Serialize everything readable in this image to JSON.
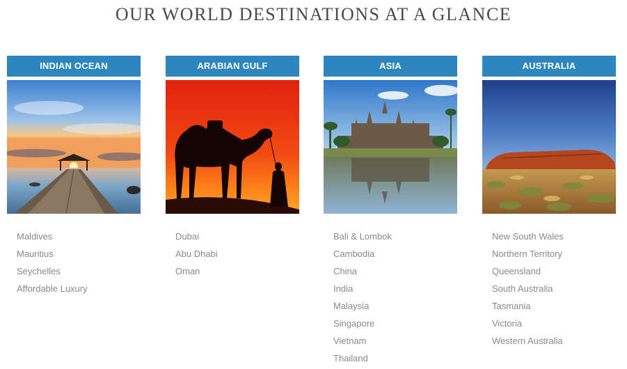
{
  "heading": "OUR WORLD DESTINATIONS AT A GLANCE",
  "accent_color": "#2d86bd",
  "columns": [
    {
      "title": "INDIAN OCEAN",
      "image": "jetty-sunset-photo",
      "items": [
        "Maldives",
        "Mauritius",
        "Seychelles",
        "Affordable Luxury"
      ]
    },
    {
      "title": "ARABIAN GULF",
      "image": "camel-silhouette-photo",
      "items": [
        "Dubai",
        "Abu Dhabi",
        "Oman"
      ]
    },
    {
      "title": "ASIA",
      "image": "angkor-wat-photo",
      "items": [
        "Bali & Lombok",
        "Cambodia",
        "China",
        "India",
        "Malaysia",
        "Singapore",
        "Vietnam",
        "Thailand"
      ]
    },
    {
      "title": "AUSTRALIA",
      "image": "uluru-photo",
      "items": [
        "New South Wales",
        "Northern Territory",
        "Queensland",
        "South Australia",
        "Tasmania",
        "Victoria",
        "Western Australia"
      ]
    }
  ]
}
